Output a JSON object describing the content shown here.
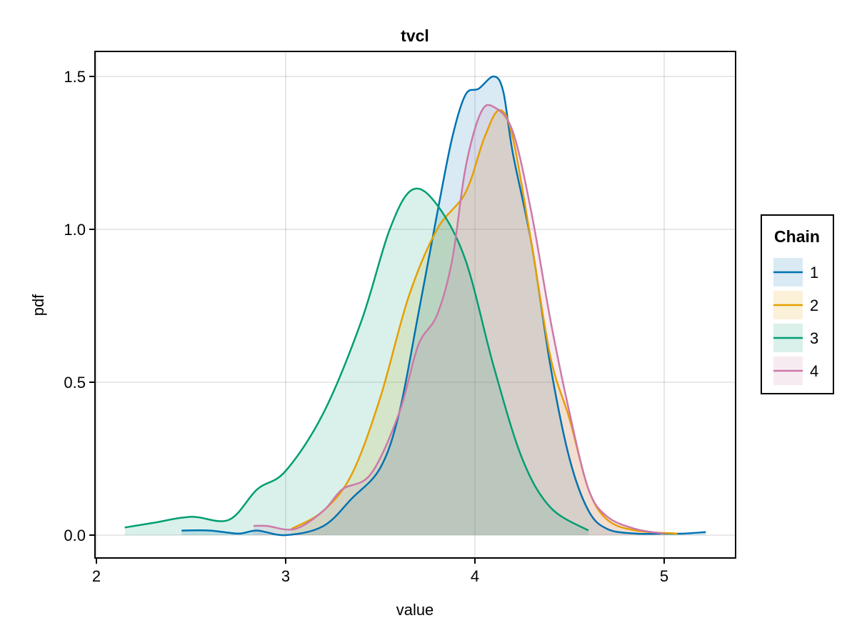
{
  "chart_data": {
    "type": "area",
    "title": "tvcl",
    "xlabel": "value",
    "ylabel": "pdf",
    "xlim": [
      2.0,
      5.35
    ],
    "ylim": [
      -0.075,
      1.58
    ],
    "xticks": [
      2,
      3,
      4,
      5
    ],
    "xtick_labels": [
      "2",
      "3",
      "4",
      "5"
    ],
    "yticks": [
      0.0,
      0.5,
      1.0,
      1.5
    ],
    "ytick_labels": [
      "0.0",
      "0.5",
      "1.0",
      "1.5"
    ],
    "grid": true,
    "legend": {
      "title": "Chain",
      "placement": "right"
    },
    "series": [
      {
        "name": "1",
        "color": "#0072b2",
        "x": [
          2.45,
          2.6,
          2.75,
          2.85,
          3.0,
          3.2,
          3.35,
          3.5,
          3.6,
          3.7,
          3.8,
          3.88,
          3.95,
          4.02,
          4.1,
          4.15,
          4.2,
          4.3,
          4.4,
          4.5,
          4.6,
          4.7,
          4.85,
          5.0,
          5.1,
          5.22
        ],
        "y": [
          0.015,
          0.015,
          0.005,
          0.015,
          0.0,
          0.03,
          0.12,
          0.22,
          0.4,
          0.72,
          1.05,
          1.3,
          1.44,
          1.46,
          1.5,
          1.45,
          1.25,
          0.95,
          0.55,
          0.25,
          0.08,
          0.02,
          0.005,
          0.005,
          0.005,
          0.01
        ]
      },
      {
        "name": "2",
        "color": "#e69f00",
        "x": [
          3.03,
          3.2,
          3.35,
          3.5,
          3.65,
          3.8,
          3.95,
          4.05,
          4.13,
          4.2,
          4.3,
          4.4,
          4.5,
          4.6,
          4.7,
          4.85,
          5.07
        ],
        "y": [
          0.02,
          0.08,
          0.2,
          0.45,
          0.78,
          1.0,
          1.12,
          1.3,
          1.39,
          1.3,
          0.95,
          0.58,
          0.38,
          0.15,
          0.05,
          0.015,
          0.005
        ]
      },
      {
        "name": "3",
        "color": "#009e73",
        "x": [
          2.15,
          2.3,
          2.5,
          2.7,
          2.85,
          3.0,
          3.2,
          3.4,
          3.55,
          3.67,
          3.8,
          3.95,
          4.1,
          4.25,
          4.4,
          4.6
        ],
        "y": [
          0.025,
          0.04,
          0.06,
          0.05,
          0.15,
          0.21,
          0.4,
          0.7,
          1.0,
          1.13,
          1.08,
          0.9,
          0.55,
          0.25,
          0.09,
          0.015
        ]
      },
      {
        "name": "4",
        "color": "#cc79a7",
        "x": [
          2.83,
          2.9,
          3.05,
          3.2,
          3.3,
          3.45,
          3.6,
          3.7,
          3.8,
          3.88,
          3.95,
          4.03,
          4.1,
          4.2,
          4.3,
          4.4,
          4.5,
          4.6,
          4.7,
          4.85,
          5.0
        ],
        "y": [
          0.03,
          0.03,
          0.02,
          0.08,
          0.15,
          0.2,
          0.4,
          0.62,
          0.72,
          0.9,
          1.2,
          1.38,
          1.4,
          1.32,
          1.05,
          0.7,
          0.4,
          0.15,
          0.06,
          0.02,
          0.005
        ]
      }
    ]
  }
}
